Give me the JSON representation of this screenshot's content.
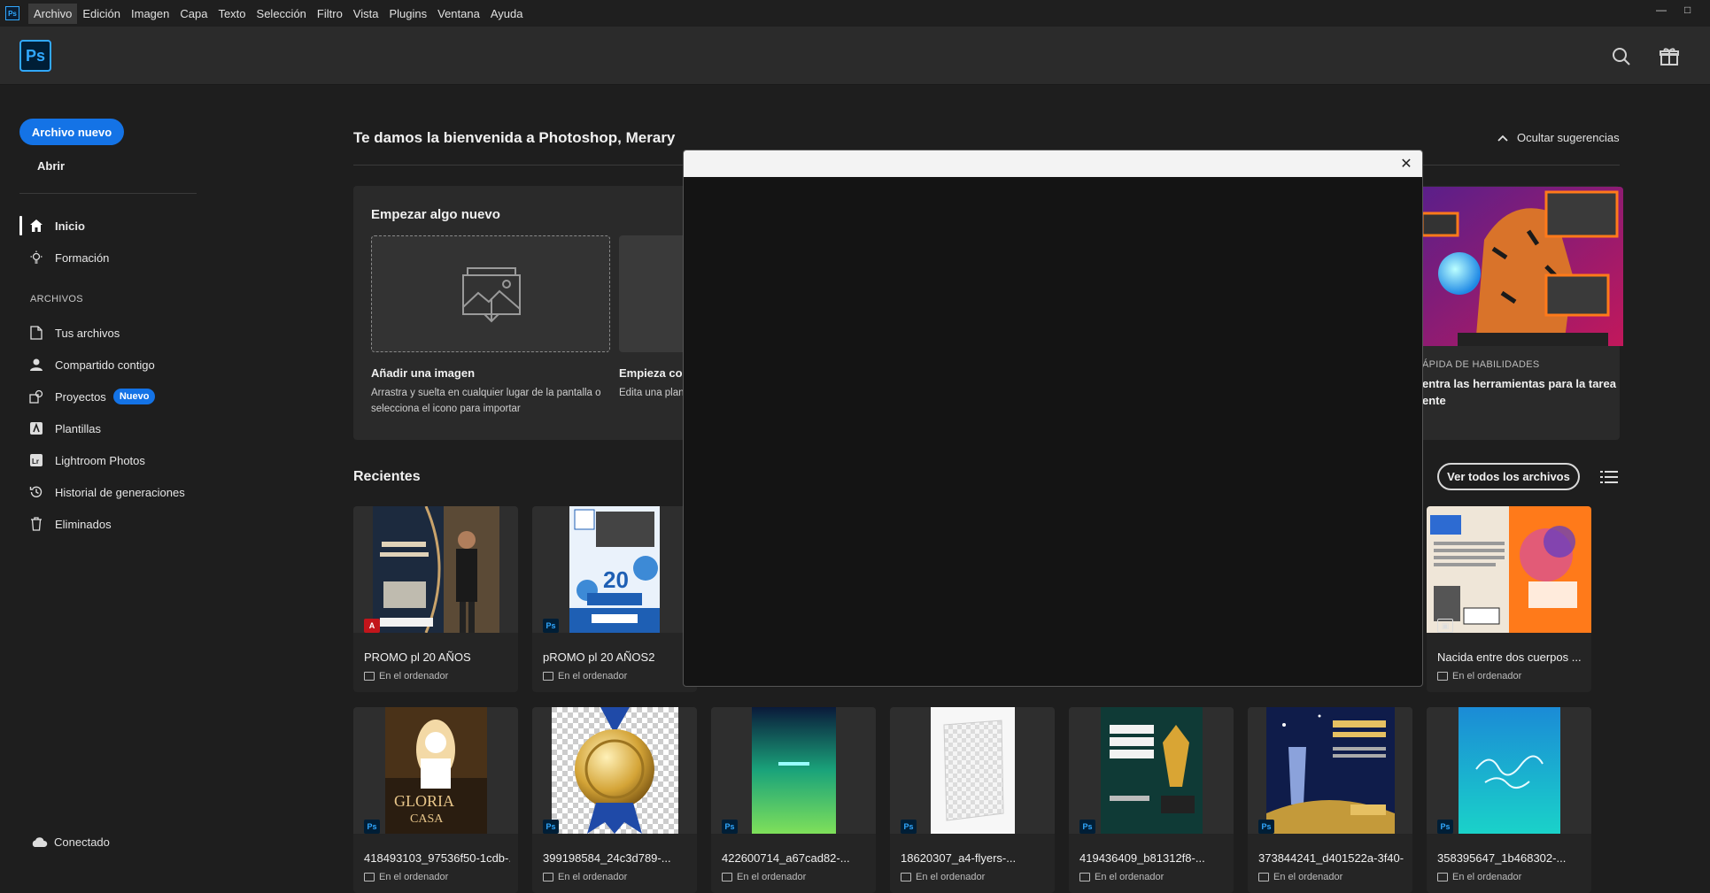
{
  "menubar": {
    "app_icon": "Ps",
    "items": [
      "Archivo",
      "Edición",
      "Imagen",
      "Capa",
      "Texto",
      "Selección",
      "Filtro",
      "Vista",
      "Plugins",
      "Ventana",
      "Ayuda"
    ],
    "window_controls": [
      "—",
      "□",
      "✕"
    ]
  },
  "appbar": {
    "logo": "Ps",
    "icons": [
      "search-icon",
      "gift-icon"
    ]
  },
  "sidebar": {
    "new_file": "Archivo nuevo",
    "open": "Abrir",
    "nav_home": "Inicio",
    "nav_learn": "Formación",
    "files_label": "ARCHIVOS",
    "nav_your_files": "Tus archivos",
    "nav_shared": "Compartido contigo",
    "nav_projects": "Proyectos",
    "projects_badge": "Nuevo",
    "nav_templates": "Plantillas",
    "nav_lightroom": "Lightroom Photos",
    "nav_history": "Historial de generaciones",
    "nav_deleted": "Eliminados",
    "connected": "Conectado"
  },
  "main": {
    "welcome": "Te damos la bienvenida a Photoshop, Merary",
    "hide_suggestions": "Ocultar sugerencias",
    "start": {
      "title": "Empezar algo nuevo",
      "card1_title": "Añadir una imagen",
      "card1_desc_line1": "Arrastra y suelta en cualquier lugar de la pantalla o",
      "card1_desc_line2": "selecciona el icono para importar",
      "card2_title": "Empieza con",
      "card2_desc": "Edita una plant"
    },
    "tutorial": {
      "kicker": "ÁPIDA DE HABILIDADES",
      "title_line1": "entra las herramientas para la tarea",
      "title_line2": "ente"
    },
    "recents_title": "Recientes",
    "view_all": "Ver todos los archivos",
    "location_label": "En el ordenador",
    "files_row1": [
      {
        "name": "PROMO pl 20 AÑOS",
        "type": "pdf"
      },
      {
        "name": "pROMO pl 20 AÑOS2",
        "type": "ps"
      },
      {
        "name": "Nacida entre dos cuerpos ...",
        "type": "img"
      }
    ],
    "files_row2": [
      {
        "name": "418493103_97536f50-1cdb-...",
        "type": "ps"
      },
      {
        "name": "399198584_24c3d789-...",
        "type": "ps"
      },
      {
        "name": "422600714_a67cad82-...",
        "type": "ps"
      },
      {
        "name": "18620307_a4-flyers-...",
        "type": "ps"
      },
      {
        "name": "419436409_b81312f8-...",
        "type": "ps"
      },
      {
        "name": "373844241_d401522a-3f40-...",
        "type": "ps"
      },
      {
        "name": "358395647_1b468302-...",
        "type": "ps"
      }
    ]
  },
  "dialog": {
    "close": "✕"
  },
  "colors": {
    "accent": "#1473e6",
    "ps_blue": "#31a8ff",
    "background": "#1e1e1e"
  }
}
